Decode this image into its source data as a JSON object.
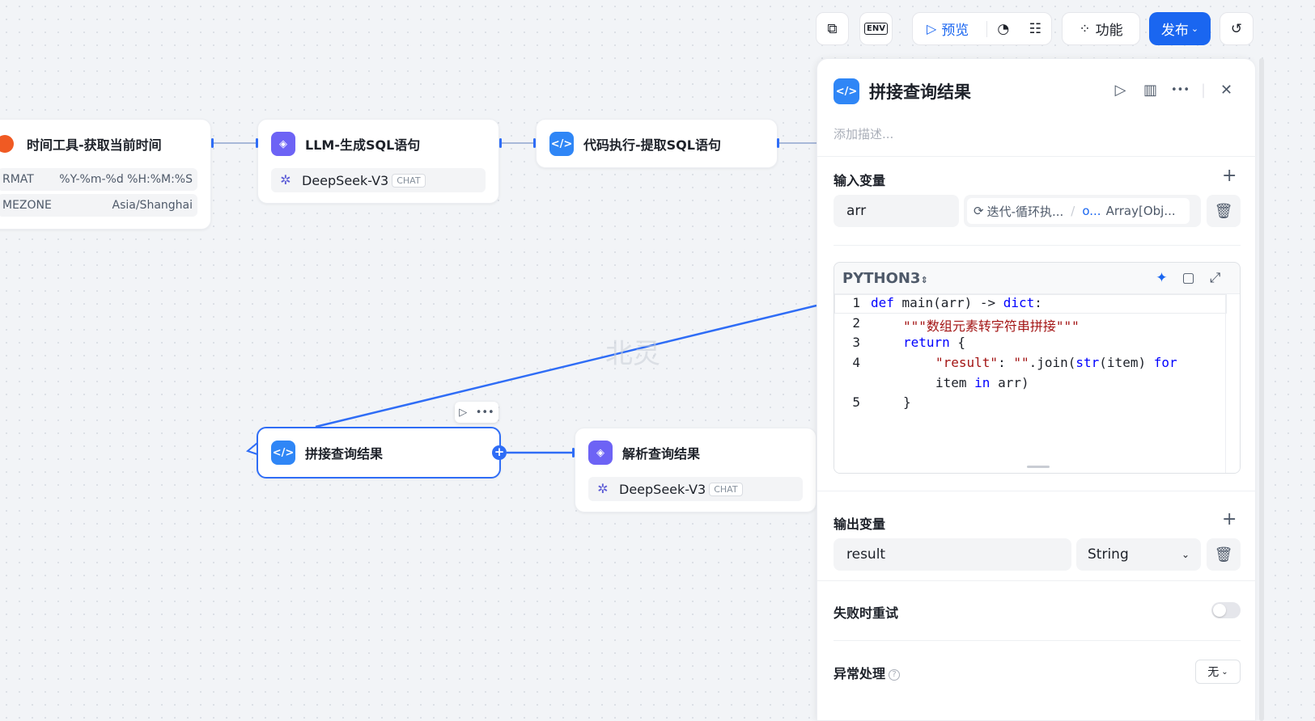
{
  "toolbar": {
    "preview_label": "预览",
    "feature_label": "功能",
    "publish_label": "发布",
    "env_label": "ENV"
  },
  "nodes": {
    "time_tool": {
      "title": "时间工具-获取当前时间",
      "params": [
        {
          "key": "RMAT",
          "value": "%Y-%m-%d %H:%M:%S"
        },
        {
          "key": "MEZONE",
          "value": "Asia/Shanghai"
        }
      ]
    },
    "llm_sql": {
      "title": "LLM-生成SQL语句",
      "model": "DeepSeek-V3",
      "tag": "CHAT"
    },
    "code_extract": {
      "title": "代码执行-提取SQL语句"
    },
    "concat": {
      "title": "拼接查询结果"
    },
    "parse": {
      "title": "解析查询结果",
      "model": "DeepSeek-V3",
      "tag": "CHAT"
    }
  },
  "watermark": "北灵",
  "panel": {
    "title": "拼接查询结果",
    "description_placeholder": "添加描述...",
    "input_section": "输入变量",
    "input_var_name": "arr",
    "input_ref_source": "迭代-循环执...",
    "input_ref_field": "o...",
    "input_ref_type": "Array[Obj...",
    "language": "PYTHON3",
    "code_lines": [
      {
        "n": "1"
      },
      {
        "n": "2"
      },
      {
        "n": "3"
      },
      {
        "n": "4"
      },
      {
        "n": "5"
      }
    ],
    "code_tokens": {
      "l1_def": "def",
      "l1_main": " main(arr) -> ",
      "l1_dict": "dict",
      "l1_colon": ":",
      "l2_doc": "\"\"\"数组元素转字符串拼接\"\"\"",
      "l3_return": "return",
      "l3_brace": " {",
      "l4_key": "\"result\"",
      "l4_colon": ": ",
      "l4_empty": "\"\"",
      "l4_join": ".join(",
      "l4_str": "str",
      "l4_item": "(item) ",
      "l4_for": "for",
      "l4b_item": "item ",
      "l4b_in": "in",
      "l4b_arr": " arr)",
      "l5_brace": "}"
    },
    "output_section": "输出变量",
    "output_var_name": "result",
    "output_var_type": "String",
    "retry_label": "失败时重试",
    "exception_label": "异常处理",
    "exception_value": "无"
  },
  "colors": {
    "accent": "#1a66f0",
    "edge": "#2f6df6",
    "code_icon": "#2f86f6",
    "llm_icon": "#6d63f5"
  }
}
